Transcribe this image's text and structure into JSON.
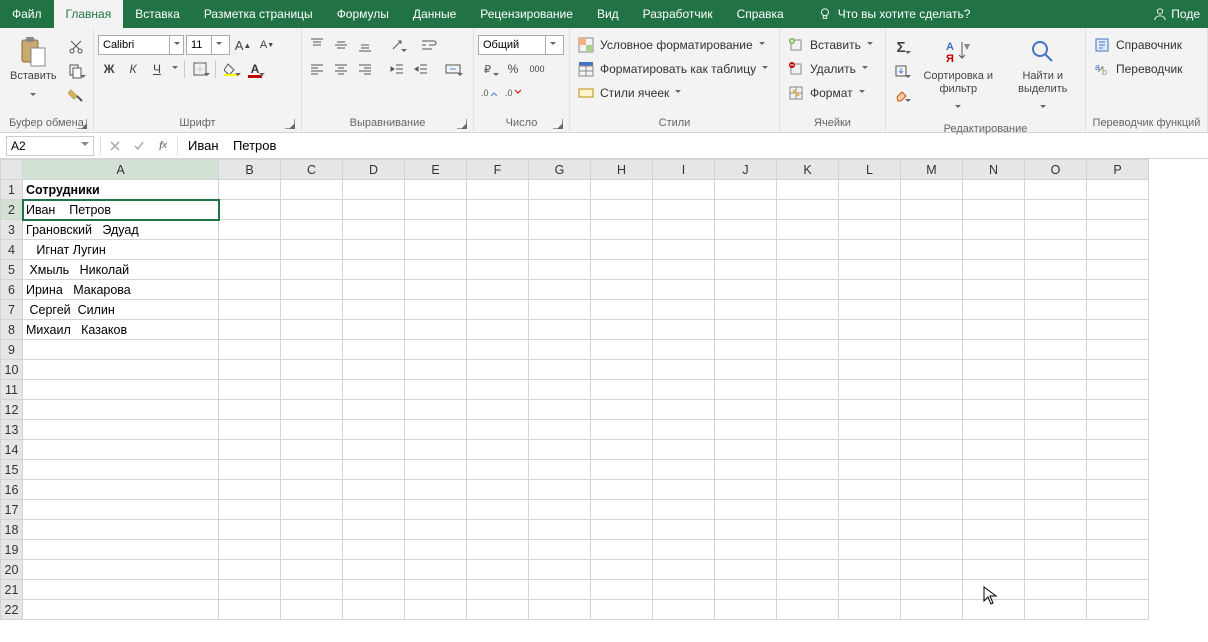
{
  "tabs": {
    "file": "Файл",
    "home": "Главная",
    "insert": "Вставка",
    "layout": "Разметка страницы",
    "formulas": "Формулы",
    "data": "Данные",
    "review": "Рецензирование",
    "view": "Вид",
    "developer": "Разработчик",
    "help": "Справка",
    "tellme": "Что вы хотите сделать?",
    "share": "Поде"
  },
  "ribbon": {
    "clipboard": {
      "label": "Буфер обмена",
      "paste": "Вставить"
    },
    "font": {
      "label": "Шрифт",
      "name": "Calibri",
      "size": "11",
      "bold": "Ж",
      "italic": "К",
      "underline": "Ч"
    },
    "alignment": {
      "label": "Выравнивание"
    },
    "number": {
      "label": "Число",
      "format": "Общий"
    },
    "styles": {
      "label": "Стили",
      "cond": "Условное форматирование",
      "table": "Форматировать как таблицу",
      "cell": "Стили ячеек"
    },
    "cells": {
      "label": "Ячейки",
      "insert": "Вставить",
      "delete": "Удалить",
      "format": "Формат"
    },
    "editing": {
      "label": "Редактирование",
      "sort": "Сортировка и фильтр",
      "find": "Найти и выделить"
    },
    "translator": {
      "label": "Переводчик функций",
      "ref": "Справочник",
      "tr": "Переводчик"
    }
  },
  "formula_bar": {
    "cell_ref": "A2",
    "value": "Иван    Петров"
  },
  "columns": [
    "A",
    "B",
    "C",
    "D",
    "E",
    "F",
    "G",
    "H",
    "I",
    "J",
    "K",
    "L",
    "M",
    "N",
    "O",
    "P"
  ],
  "rows": [
    {
      "n": 1,
      "a": "Сотрудники",
      "bold": true
    },
    {
      "n": 2,
      "a": "Иван    Петров",
      "active": true
    },
    {
      "n": 3,
      "a": "Грановский   Эдуад"
    },
    {
      "n": 4,
      "a": "   Игнат Лугин"
    },
    {
      "n": 5,
      "a": " Хмыль   Николай"
    },
    {
      "n": 6,
      "a": "Ирина   Макарова"
    },
    {
      "n": 7,
      "a": " Сергей  Силин"
    },
    {
      "n": 8,
      "a": "Михаил   Казаков"
    },
    {
      "n": 9,
      "a": ""
    },
    {
      "n": 10,
      "a": ""
    },
    {
      "n": 11,
      "a": ""
    },
    {
      "n": 12,
      "a": ""
    },
    {
      "n": 13,
      "a": ""
    },
    {
      "n": 14,
      "a": ""
    },
    {
      "n": 15,
      "a": ""
    },
    {
      "n": 16,
      "a": ""
    },
    {
      "n": 17,
      "a": ""
    },
    {
      "n": 18,
      "a": ""
    },
    {
      "n": 19,
      "a": ""
    },
    {
      "n": 20,
      "a": ""
    },
    {
      "n": 21,
      "a": ""
    },
    {
      "n": 22,
      "a": ""
    }
  ],
  "number_icons": {
    "percent": "%",
    "thousand": "000"
  }
}
